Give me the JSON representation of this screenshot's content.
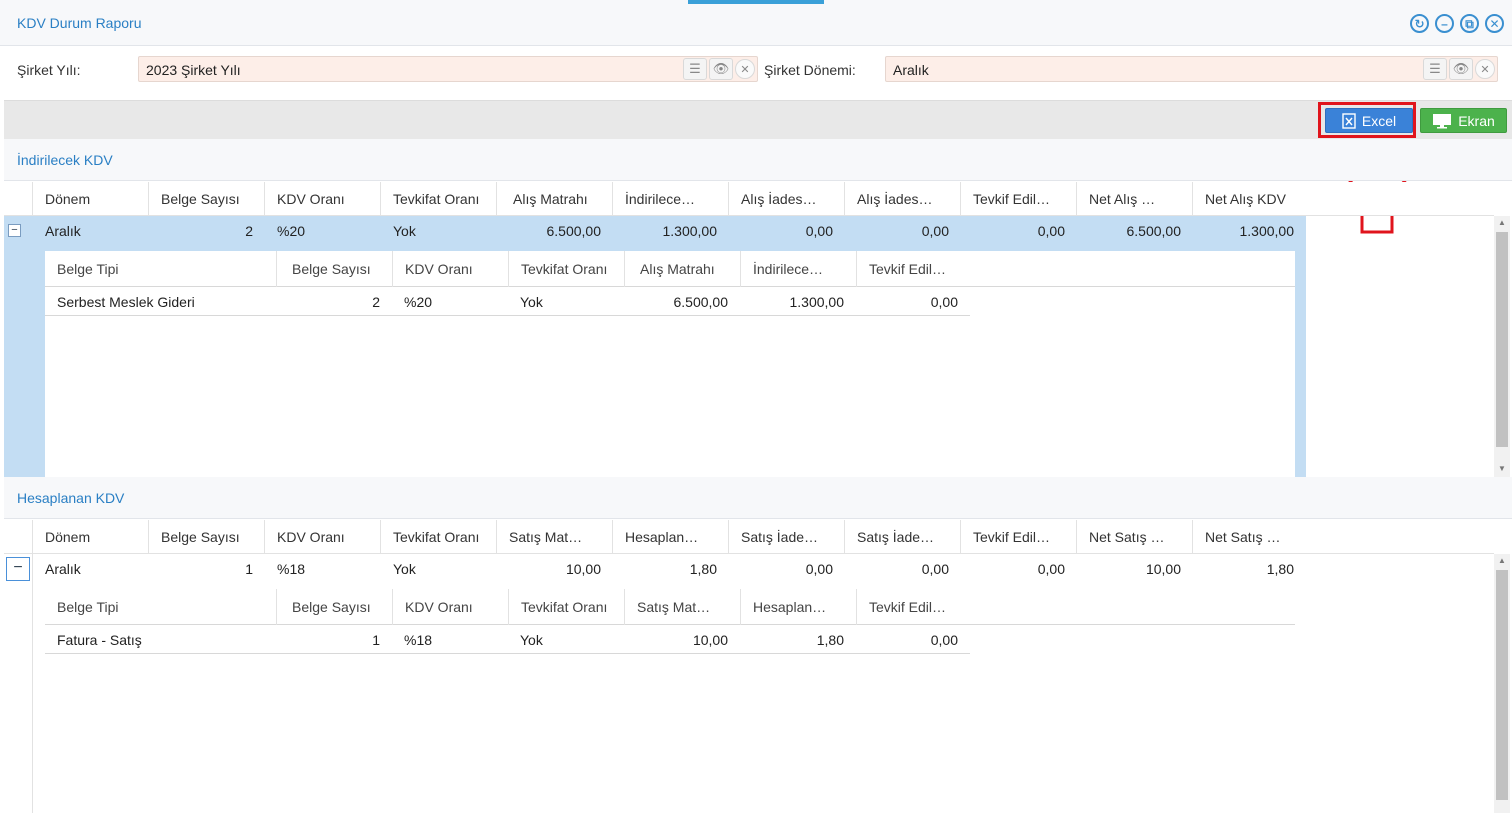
{
  "window": {
    "title": "KDV Durum Raporu",
    "buttons": [
      "refresh-icon",
      "minimize-icon",
      "maximize-icon",
      "close-icon"
    ]
  },
  "filters": {
    "year_label": "Şirket Yılı:",
    "year_value": "2023 Şirket Yılı",
    "period_label": "Şirket Dönemi:",
    "period_value": "Aralık"
  },
  "toolbar": {
    "excel_label": "Excel",
    "ekran_label": "Ekran",
    "highlight_color": "#e0141c"
  },
  "indirilecek": {
    "section_title": "İndirilecek KDV",
    "columns": [
      "Dönem",
      "Belge Sayısı",
      "KDV Oranı",
      "Tevkifat Oranı",
      "Alış Matrahı",
      "İndirilece…",
      "Alış İades…",
      "Alış İades…",
      "Tevkif Edil…",
      "Net Alış …",
      "Net Alış KDV"
    ],
    "row": [
      "Aralık",
      "2",
      "%20",
      "Yok",
      "6.500,00",
      "1.300,00",
      "0,00",
      "0,00",
      "0,00",
      "6.500,00",
      "1.300,00"
    ],
    "detail_columns": [
      "Belge Tipi",
      "Belge Sayısı",
      "KDV Oranı",
      "Tevkifat Oranı",
      "Alış Matrahı",
      "İndirilece…",
      "Tevkif Edil…"
    ],
    "detail_row": [
      "Serbest Meslek Gideri",
      "2",
      "%20",
      "Yok",
      "6.500,00",
      "1.300,00",
      "0,00"
    ]
  },
  "hesaplanan": {
    "section_title": "Hesaplanan KDV",
    "columns": [
      "Dönem",
      "Belge Sayısı",
      "KDV Oranı",
      "Tevkifat Oranı",
      "Satış Mat…",
      "Hesaplan…",
      "Satış İade…",
      "Satış İade…",
      "Tevkif Edil…",
      "Net Satış …",
      "Net Satış …"
    ],
    "row": [
      "Aralık",
      "1",
      "%18",
      "Yok",
      "10,00",
      "1,80",
      "0,00",
      "0,00",
      "0,00",
      "10,00",
      "1,80"
    ],
    "detail_columns": [
      "Belge Tipi",
      "Belge Sayısı",
      "KDV Oranı",
      "Tevkifat Oranı",
      "Satış Mat…",
      "Hesaplan…",
      "Tevkif Edil…"
    ],
    "detail_row": [
      "Fatura - Satış",
      "1",
      "%18",
      "Yok",
      "10,00",
      "1,80",
      "0,00"
    ]
  },
  "colors": {
    "accent": "#2a7fc4",
    "selected_row": "#c3ddf3",
    "excel": "#3a82d8",
    "ekran": "#4cb24c"
  }
}
